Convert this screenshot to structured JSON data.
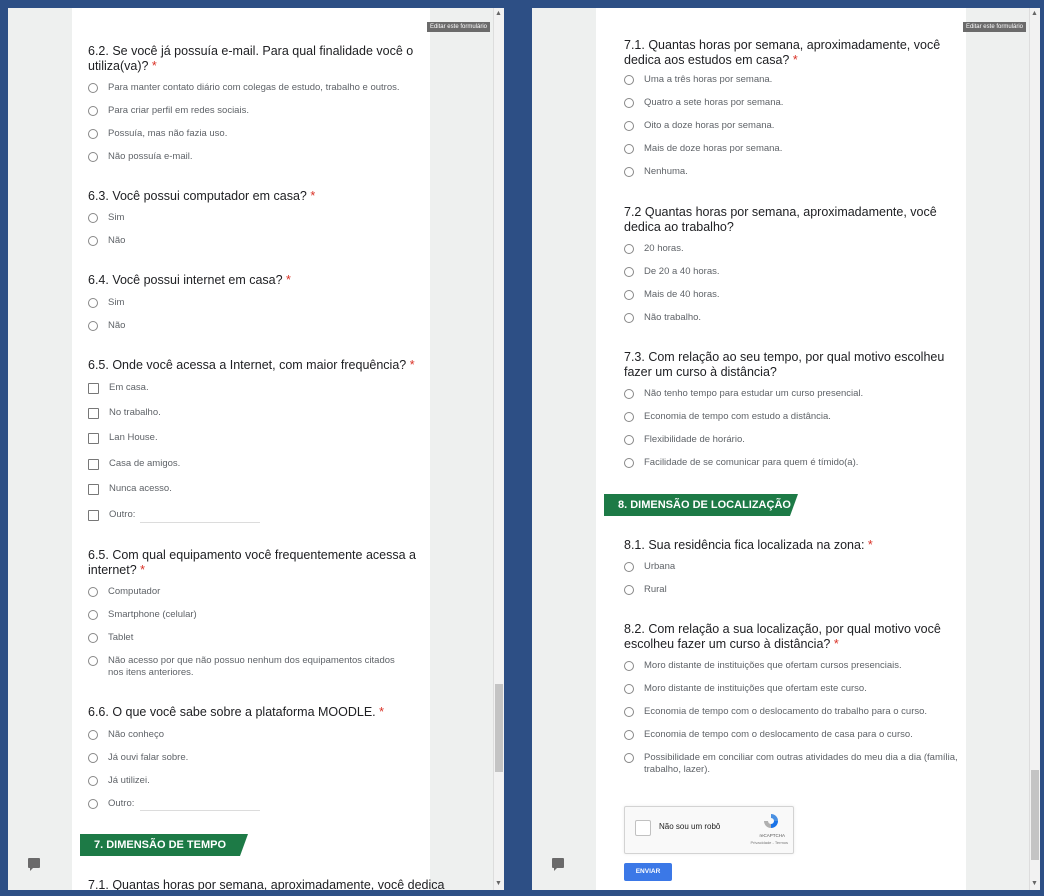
{
  "left": {
    "edit_label": "Editar este formulário",
    "q62": {
      "title": "6.2. Se você já possuía e-mail. Para qual finalidade você o utiliza(va)?",
      "required": "*",
      "options": [
        "Para manter contato diário com colegas de estudo, trabalho e outros.",
        "Para criar perfil em redes sociais.",
        "Possuía, mas não fazia uso.",
        "Não possuía e-mail."
      ]
    },
    "q63": {
      "title": "6.3. Você possui computador em casa?",
      "required": "*",
      "options": [
        "Sim",
        "Não"
      ]
    },
    "q64": {
      "title": "6.4. Você possui internet em casa?",
      "required": "*",
      "options": [
        "Sim",
        "Não"
      ]
    },
    "q65": {
      "title": "6.5. Onde você acessa a Internet, com maior frequência?",
      "required": "*",
      "options": [
        "Em casa.",
        "No trabalho.",
        "Lan House.",
        "Casa de amigos.",
        "Nunca acesso.",
        "Outro:"
      ]
    },
    "q65b": {
      "title": "6.5. Com qual equipamento você frequentemente acessa a internet?",
      "required": "*",
      "options": [
        "Computador",
        "Smartphone (celular)",
        "Tablet",
        "Não acesso por que não possuo nenhum dos equipamentos citados nos itens anteriores."
      ]
    },
    "q66": {
      "title": "6.6. O que você sabe sobre a plataforma MOODLE.",
      "required": "*",
      "options": [
        "Não conheço",
        "Já ouvi falar sobre.",
        "Já utilizei.",
        "Outro:"
      ]
    },
    "section7": "7. DIMENSÃO DE TEMPO",
    "cut_text": "7.1. Quantas horas por semana, aproximadamente, você dedica"
  },
  "right": {
    "edit_label": "Editar este formulário",
    "q71": {
      "title": "7.1. Quantas horas por semana, aproximadamente, você dedica aos estudos em casa?",
      "required": "*",
      "options": [
        "Uma a três horas por semana.",
        "Quatro a sete horas por semana.",
        "Oito a doze horas por semana.",
        "Mais de doze horas por semana.",
        "Nenhuma."
      ]
    },
    "q72": {
      "title": "7.2 Quantas horas por semana, aproximadamente, você dedica ao trabalho?",
      "required": "",
      "options": [
        "20 horas.",
        "De 20 a 40 horas.",
        "Mais de 40 horas.",
        "Não trabalho."
      ]
    },
    "q73": {
      "title": "7.3. Com relação ao seu tempo, por qual motivo escolheu fazer um curso à distância?",
      "required": "",
      "options": [
        "Não tenho tempo para estudar um curso presencial.",
        "Economia de tempo com estudo a distância.",
        "Flexibilidade de horário.",
        "Facilidade de se comunicar para quem é tímido(a)."
      ]
    },
    "section8": "8. DIMENSÃO DE LOCALIZAÇÃO",
    "q81": {
      "title": "8.1. Sua residência fica localizada na zona:",
      "required": "*",
      "options": [
        "Urbana",
        "Rural"
      ]
    },
    "q82": {
      "title": "8.2. Com relação a sua localização, por qual motivo você escolheu fazer um curso à distância?",
      "required": "*",
      "options": [
        "Moro distante de instituições que ofertam cursos presenciais.",
        "Moro distante de instituições que ofertam este curso.",
        "Economia de tempo com o deslocamento do trabalho para o curso.",
        "Economia de tempo com o deslocamento de casa para o curso.",
        "Possibilidade em conciliar com outras atividades do meu dia a dia (família, trabalho, lazer)."
      ]
    },
    "recaptcha": {
      "label": "Não sou um robô",
      "brand": "reCAPTCHA",
      "terms": "Privacidade - Termos"
    },
    "submit": "ENVIAR"
  }
}
